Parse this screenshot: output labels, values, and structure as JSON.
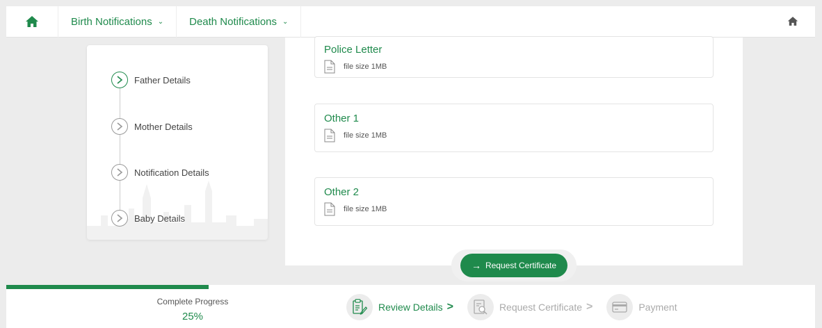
{
  "nav": {
    "home_icon": "home-icon",
    "items": [
      {
        "label": "Birth Notifications",
        "caret": "⌄"
      },
      {
        "label": "Death Notifications",
        "caret": "⌄"
      }
    ],
    "right_icon": "home-icon"
  },
  "steps": [
    {
      "label": "Father Details",
      "active": true
    },
    {
      "label": "Mother Details",
      "active": false
    },
    {
      "label": "Notification Details",
      "active": false
    },
    {
      "label": "Baby Details",
      "active": false
    }
  ],
  "documents": [
    {
      "title": "Police Letter",
      "meta": "file size 1MB"
    },
    {
      "title": "Other 1",
      "meta": "file size 1MB"
    },
    {
      "title": "Other 2",
      "meta": "file size 1MB"
    }
  ],
  "request_button": {
    "label": "Request Certificate",
    "icon": "arrow-right-icon"
  },
  "progress": {
    "label": "Complete Progress",
    "value": "25%",
    "fraction": 0.25
  },
  "wizard": [
    {
      "label": "Review Details",
      "icon": "clipboard-edit-icon",
      "active": true
    },
    {
      "label": "Request Certificate",
      "icon": "document-search-icon",
      "active": false
    },
    {
      "label": "Payment",
      "icon": "credit-card-icon",
      "active": false
    }
  ],
  "colors": {
    "accent": "#1f8a4c",
    "background": "#ececec",
    "inactive": "#aaaaaa"
  }
}
